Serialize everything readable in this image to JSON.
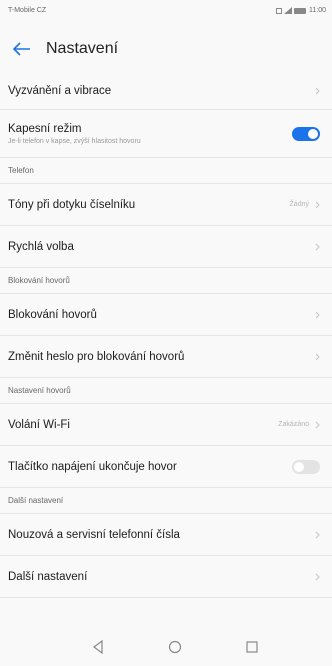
{
  "status_bar": {
    "carrier": "T-Mobile CZ",
    "time": "11:00"
  },
  "header": {
    "title": "Nastavení",
    "back_icon": "arrow-left-icon"
  },
  "rows": {
    "ringtones": {
      "label": "Vyzvánění a vibrace"
    },
    "pocket_mode": {
      "label": "Kapesní režim",
      "sub": "Je-li telefon v kapse, zvýší hlasitost hovoru",
      "toggle": "on"
    },
    "dial_tones": {
      "label": "Tóny při dotyku číselníku",
      "value": "Žádný"
    },
    "speed_dial": {
      "label": "Rychlá volba"
    },
    "call_block": {
      "label": "Blokování hovorů"
    },
    "block_password": {
      "label": "Změnit heslo pro blokování hovorů"
    },
    "wifi_calling": {
      "label": "Volání Wi-Fi",
      "value": "Zakázáno"
    },
    "power_ends_call": {
      "label": "Tlačítko napájení ukončuje hovor",
      "toggle": "off"
    },
    "emergency": {
      "label": "Nouzová a servisní telefonní čísla"
    },
    "more_settings": {
      "label": "Další nastavení"
    }
  },
  "sections": {
    "telefon": "Telefon",
    "blokovani": "Blokování hovorů",
    "nastaveni_hovoru": "Nastavení hovorů",
    "dalsi": "Další nastavení"
  },
  "navbar": {
    "icons": [
      "back-triangle-icon",
      "home-circle-icon",
      "recents-square-icon"
    ]
  },
  "colors": {
    "accent": "#1a73e8",
    "background": "#f9f9f9",
    "divider": "#e6e6e6"
  }
}
